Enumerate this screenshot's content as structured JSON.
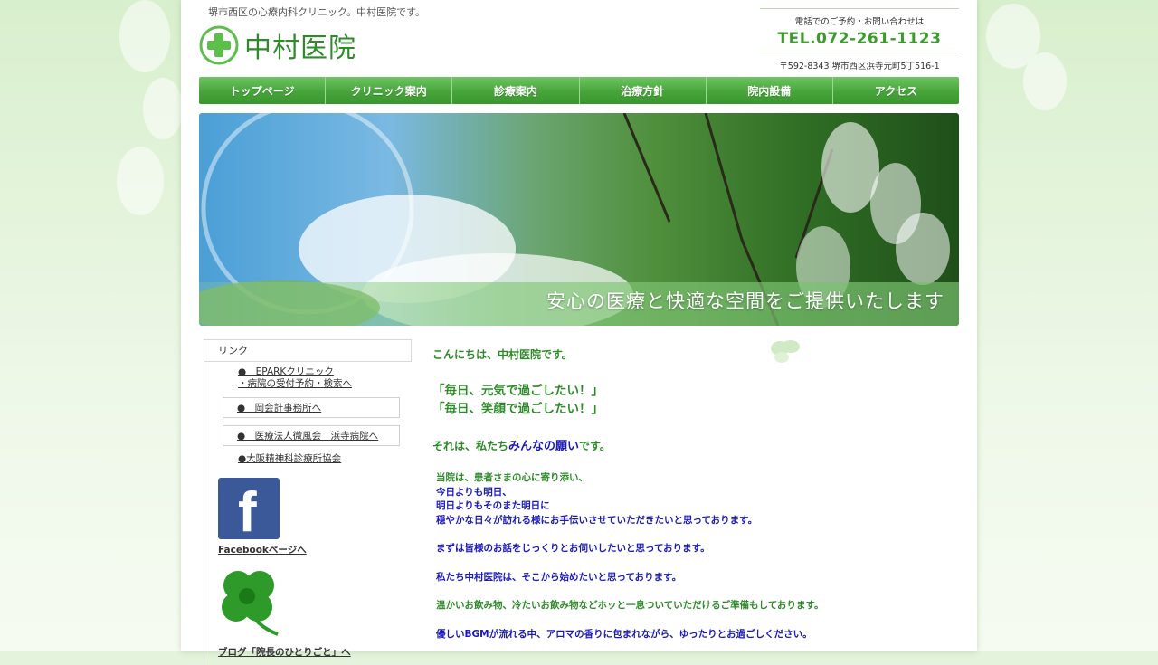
{
  "header": {
    "tagline": "堺市西区の心療内科クリニック。中村医院です。",
    "logo_text": "中村医院",
    "contact_label": "電話でのご予約・お問い合わせは",
    "tel": "TEL.072-261-1123",
    "address": "〒592-8343 堺市西区浜寺元町5丁516-1"
  },
  "nav": {
    "items": [
      "トップページ",
      "クリニック案内",
      "診療案内",
      "治療方針",
      "院内設備",
      "アクセス"
    ]
  },
  "hero": {
    "caption": "安心の医療と快適な空間をご提供いたします"
  },
  "sidebar": {
    "title": "リンク",
    "link1_line1": "●　EPARKクリニック",
    "link1_line2": "・病院の受付予約・検索へ",
    "link2": "●　岡会計事務所へ",
    "link3": "●　医療法人微風会　浜寺病院へ",
    "link4": "●大阪精神科診療所協会",
    "facebook_label": "Facebookページへ",
    "blog_label": "ブログ「院長のひとりごと」へ"
  },
  "main": {
    "greeting": "こんにちは、中村医院です。",
    "motto1": "「毎日、元気で過ごしたい！」",
    "motto2": "「毎日、笑顔で過ごしたい！」",
    "wish_prefix": "それは、私たち",
    "wish_highlight": "みんなの願い",
    "wish_suffix": "です。",
    "p1": "当院は、患者さまの心に寄り添い、",
    "p2": "今日よりも明日、",
    "p3": "明日よりもそのまた明日に",
    "p4": "穏やかな日々が訪れる様にお手伝いさせていただきたいと思っております。",
    "p5": "まずは皆様のお話をじっくりとお伺いしたいと思っております。",
    "p6": "私たち中村医院は、そこから始めたいと思っております。",
    "p7": "温かいお飲み物、冷たいお飲み物などホッと一息ついていただけるご準備もしております。",
    "p8": "優しいBGMが流れる中、アロマの香りに包まれながら、ゆったりとお過ごしください。"
  },
  "colors": {
    "brand_green": "#2f8a2a",
    "nav_green": "#46a53a",
    "accent_blue": "#1a1ab8"
  }
}
